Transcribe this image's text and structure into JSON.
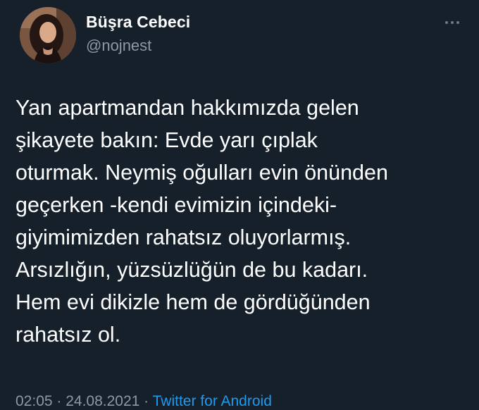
{
  "author": {
    "name": "Büşra Cebeci",
    "handle": "@nojnest"
  },
  "tweet": {
    "lines": [
      "Yan apartmandan hakkımızda gelen",
      "şikayete bakın: Evde yarı çıplak",
      "oturmak. Neymiş oğulları evin önünden",
      "geçerken -kendi evimizin içindeki-",
      "giyimimizden rahatsız oluyorlarmış.",
      "Arsızlığın, yüzsüzlüğün de bu kadarı.",
      "Hem evi dikizle hem de gördüğünden",
      "rahatsız ol."
    ]
  },
  "meta": {
    "time": "02:05",
    "separator1": " · ",
    "date": "24.08.2021",
    "separator2": " · ",
    "source": "Twitter for Android"
  },
  "icons": {
    "more": "more-horizontal-icon",
    "avatar": "profile-photo"
  },
  "colors": {
    "background": "#15202b",
    "text": "#ffffff",
    "secondary": "#8b98a5",
    "link": "#1d9bf0"
  }
}
